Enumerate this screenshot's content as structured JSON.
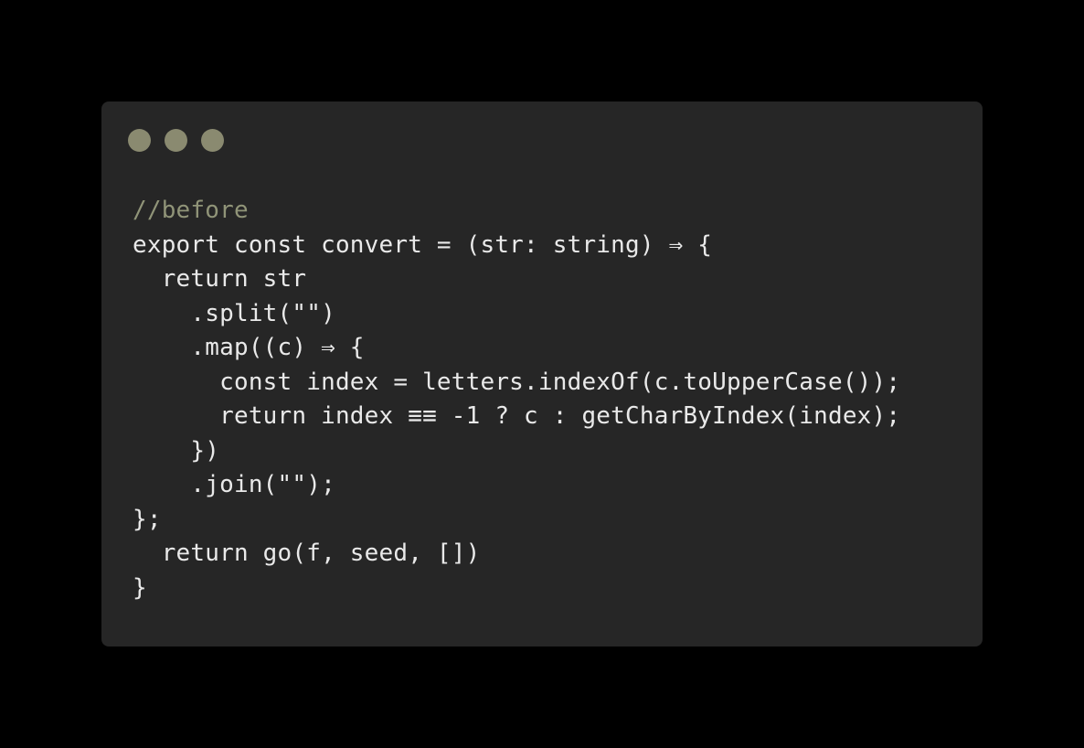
{
  "window": {
    "dot_color": "#8a8a70",
    "background": "#262626"
  },
  "code": {
    "comment_color": "#909478",
    "text_color": "#e9e9e9",
    "lines": [
      "//before",
      "export const convert = (str: string) ⇒ {",
      "  return str",
      "    .split(\"\")",
      "    .map((c) ⇒ {",
      "      const index = letters.indexOf(c.toUpperCase());",
      "      return index ≡≡ -1 ? c : getCharByIndex(index);",
      "    })",
      "    .join(\"\");",
      "};",
      "  return go(f, seed, [])",
      "}"
    ]
  }
}
